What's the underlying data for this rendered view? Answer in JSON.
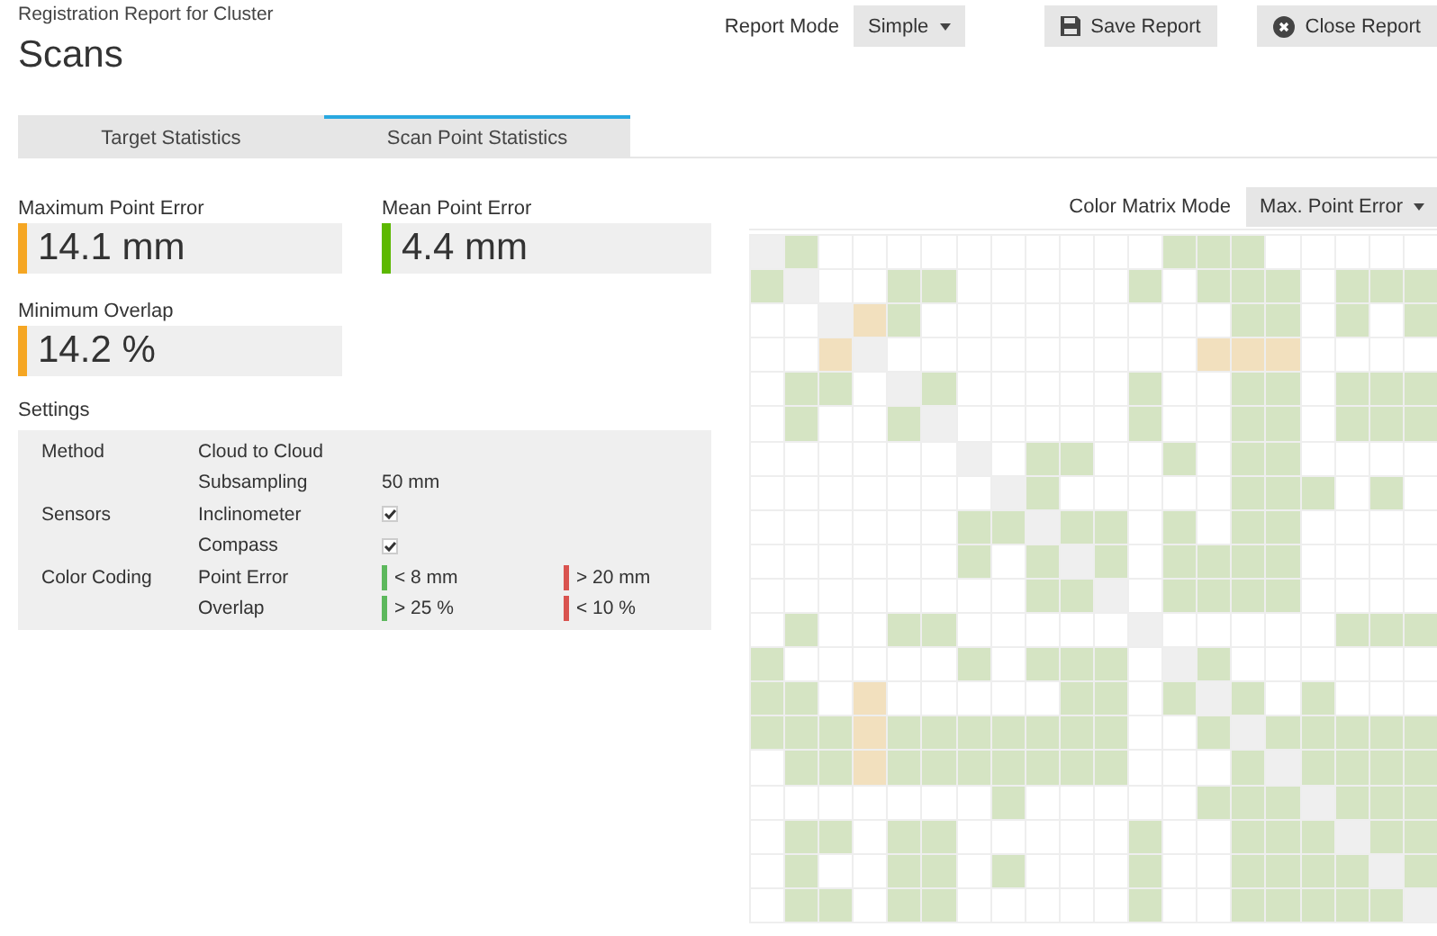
{
  "header": {
    "subtitle": "Registration Report for Cluster",
    "title": "Scans"
  },
  "toolbar": {
    "report_mode_label": "Report Mode",
    "report_mode": "Simple",
    "buttons": [
      {
        "label": "Save Report",
        "kind": "save"
      },
      {
        "label": "Close Report",
        "kind": "close"
      }
    ]
  },
  "tabs": [
    {
      "label": "Target Statistics",
      "selected": false
    },
    {
      "label": "Scan Point Statistics",
      "selected": true
    }
  ],
  "stats": [
    {
      "label": "Maximum Point Error",
      "value": "14.1 mm",
      "color": "#f5a623"
    },
    {
      "label": "Mean Point Error",
      "value": "4.4 mm",
      "color": "#5cb800"
    },
    {
      "label": "Minimum Overlap",
      "value": "14.2 %",
      "color": "#f5a623"
    }
  ],
  "settings": {
    "title": "Settings",
    "rows": [
      {
        "group": "Method",
        "name": "Cloud to Cloud",
        "kind": "text"
      },
      {
        "name": "Subsampling",
        "value": "50 mm",
        "kind": "text"
      },
      {
        "group": "Sensors",
        "name": "Inclinometer",
        "kind": "check",
        "checked": true
      },
      {
        "name": "Compass",
        "kind": "check",
        "checked": true
      },
      {
        "group": "Color Coding",
        "name": "Point Error",
        "kind": "legend",
        "good": "< 8 mm",
        "bad": "> 20 mm"
      },
      {
        "name": "Overlap",
        "kind": "legend",
        "good": "> 25 %",
        "bad": "< 10 %"
      }
    ]
  },
  "matrix": {
    "mode_label": "Color Matrix Mode",
    "mode": "Max. Point Error",
    "rows": [
      [
        {
          "kind": "diag"
        },
        {
          "kind": "good"
        },
        {
          "kind": "none"
        },
        {
          "kind": "none"
        },
        {
          "kind": "none"
        },
        {
          "kind": "none"
        },
        {
          "kind": "none"
        },
        {
          "kind": "none"
        },
        {
          "kind": "none"
        },
        {
          "kind": "none"
        },
        {
          "kind": "none"
        },
        {
          "kind": "none"
        },
        {
          "kind": "good"
        },
        {
          "kind": "good"
        },
        {
          "kind": "good"
        },
        {
          "kind": "none"
        },
        {
          "kind": "none"
        },
        {
          "kind": "none"
        },
        {
          "kind": "none"
        },
        {
          "kind": "none"
        }
      ],
      [
        {
          "kind": "good"
        },
        {
          "kind": "diag"
        },
        {
          "kind": "none"
        },
        {
          "kind": "none"
        },
        {
          "kind": "good"
        },
        {
          "kind": "good"
        },
        {
          "kind": "none"
        },
        {
          "kind": "none"
        },
        {
          "kind": "none"
        },
        {
          "kind": "none"
        },
        {
          "kind": "none"
        },
        {
          "kind": "good"
        },
        {
          "kind": "none"
        },
        {
          "kind": "good"
        },
        {
          "kind": "good"
        },
        {
          "kind": "good"
        },
        {
          "kind": "none"
        },
        {
          "kind": "good"
        },
        {
          "kind": "good"
        },
        {
          "kind": "good"
        }
      ],
      [
        {
          "kind": "none"
        },
        {
          "kind": "none"
        },
        {
          "kind": "diag"
        },
        {
          "kind": "warn"
        },
        {
          "kind": "good"
        },
        {
          "kind": "none"
        },
        {
          "kind": "none"
        },
        {
          "kind": "none"
        },
        {
          "kind": "none"
        },
        {
          "kind": "none"
        },
        {
          "kind": "none"
        },
        {
          "kind": "none"
        },
        {
          "kind": "none"
        },
        {
          "kind": "none"
        },
        {
          "kind": "good"
        },
        {
          "kind": "good"
        },
        {
          "kind": "none"
        },
        {
          "kind": "good"
        },
        {
          "kind": "none"
        },
        {
          "kind": "good"
        }
      ],
      [
        {
          "kind": "none"
        },
        {
          "kind": "none"
        },
        {
          "kind": "warn"
        },
        {
          "kind": "diag"
        },
        {
          "kind": "none"
        },
        {
          "kind": "none"
        },
        {
          "kind": "none"
        },
        {
          "kind": "none"
        },
        {
          "kind": "none"
        },
        {
          "kind": "none"
        },
        {
          "kind": "none"
        },
        {
          "kind": "none"
        },
        {
          "kind": "none"
        },
        {
          "kind": "warn"
        },
        {
          "kind": "warn"
        },
        {
          "kind": "warn"
        },
        {
          "kind": "none"
        },
        {
          "kind": "none"
        },
        {
          "kind": "none"
        },
        {
          "kind": "none"
        }
      ],
      [
        {
          "kind": "none"
        },
        {
          "kind": "good"
        },
        {
          "kind": "good"
        },
        {
          "kind": "none"
        },
        {
          "kind": "diag"
        },
        {
          "kind": "good"
        },
        {
          "kind": "none"
        },
        {
          "kind": "none"
        },
        {
          "kind": "none"
        },
        {
          "kind": "none"
        },
        {
          "kind": "none"
        },
        {
          "kind": "good"
        },
        {
          "kind": "none"
        },
        {
          "kind": "none"
        },
        {
          "kind": "good"
        },
        {
          "kind": "good"
        },
        {
          "kind": "none"
        },
        {
          "kind": "good"
        },
        {
          "kind": "good"
        },
        {
          "kind": "good"
        }
      ],
      [
        {
          "kind": "none"
        },
        {
          "kind": "good"
        },
        {
          "kind": "none"
        },
        {
          "kind": "none"
        },
        {
          "kind": "good"
        },
        {
          "kind": "diag"
        },
        {
          "kind": "none"
        },
        {
          "kind": "none"
        },
        {
          "kind": "none"
        },
        {
          "kind": "none"
        },
        {
          "kind": "none"
        },
        {
          "kind": "good"
        },
        {
          "kind": "none"
        },
        {
          "kind": "none"
        },
        {
          "kind": "good"
        },
        {
          "kind": "good"
        },
        {
          "kind": "none"
        },
        {
          "kind": "good"
        },
        {
          "kind": "good"
        },
        {
          "kind": "good"
        }
      ],
      [
        {
          "kind": "none"
        },
        {
          "kind": "none"
        },
        {
          "kind": "none"
        },
        {
          "kind": "none"
        },
        {
          "kind": "none"
        },
        {
          "kind": "none"
        },
        {
          "kind": "diag"
        },
        {
          "kind": "none"
        },
        {
          "kind": "good"
        },
        {
          "kind": "good"
        },
        {
          "kind": "none"
        },
        {
          "kind": "none"
        },
        {
          "kind": "good"
        },
        {
          "kind": "none"
        },
        {
          "kind": "good"
        },
        {
          "kind": "good"
        },
        {
          "kind": "none"
        },
        {
          "kind": "none"
        },
        {
          "kind": "none"
        },
        {
          "kind": "none"
        }
      ],
      [
        {
          "kind": "none"
        },
        {
          "kind": "none"
        },
        {
          "kind": "none"
        },
        {
          "kind": "none"
        },
        {
          "kind": "none"
        },
        {
          "kind": "none"
        },
        {
          "kind": "none"
        },
        {
          "kind": "diag"
        },
        {
          "kind": "good"
        },
        {
          "kind": "none"
        },
        {
          "kind": "none"
        },
        {
          "kind": "none"
        },
        {
          "kind": "none"
        },
        {
          "kind": "none"
        },
        {
          "kind": "good"
        },
        {
          "kind": "good"
        },
        {
          "kind": "good"
        },
        {
          "kind": "none"
        },
        {
          "kind": "good"
        },
        {
          "kind": "none"
        }
      ],
      [
        {
          "kind": "none"
        },
        {
          "kind": "none"
        },
        {
          "kind": "none"
        },
        {
          "kind": "none"
        },
        {
          "kind": "none"
        },
        {
          "kind": "none"
        },
        {
          "kind": "good"
        },
        {
          "kind": "good"
        },
        {
          "kind": "diag"
        },
        {
          "kind": "good"
        },
        {
          "kind": "good"
        },
        {
          "kind": "none"
        },
        {
          "kind": "good"
        },
        {
          "kind": "none"
        },
        {
          "kind": "good"
        },
        {
          "kind": "good"
        },
        {
          "kind": "none"
        },
        {
          "kind": "none"
        },
        {
          "kind": "none"
        },
        {
          "kind": "none"
        }
      ],
      [
        {
          "kind": "none"
        },
        {
          "kind": "none"
        },
        {
          "kind": "none"
        },
        {
          "kind": "none"
        },
        {
          "kind": "none"
        },
        {
          "kind": "none"
        },
        {
          "kind": "good"
        },
        {
          "kind": "none"
        },
        {
          "kind": "good"
        },
        {
          "kind": "diag"
        },
        {
          "kind": "good"
        },
        {
          "kind": "none"
        },
        {
          "kind": "good"
        },
        {
          "kind": "good"
        },
        {
          "kind": "good"
        },
        {
          "kind": "good"
        },
        {
          "kind": "none"
        },
        {
          "kind": "none"
        },
        {
          "kind": "none"
        },
        {
          "kind": "none"
        }
      ],
      [
        {
          "kind": "none"
        },
        {
          "kind": "none"
        },
        {
          "kind": "none"
        },
        {
          "kind": "none"
        },
        {
          "kind": "none"
        },
        {
          "kind": "none"
        },
        {
          "kind": "none"
        },
        {
          "kind": "none"
        },
        {
          "kind": "good"
        },
        {
          "kind": "good"
        },
        {
          "kind": "diag"
        },
        {
          "kind": "none"
        },
        {
          "kind": "good"
        },
        {
          "kind": "good"
        },
        {
          "kind": "good"
        },
        {
          "kind": "good"
        },
        {
          "kind": "none"
        },
        {
          "kind": "none"
        },
        {
          "kind": "none"
        },
        {
          "kind": "none"
        }
      ],
      [
        {
          "kind": "none"
        },
        {
          "kind": "good"
        },
        {
          "kind": "none"
        },
        {
          "kind": "none"
        },
        {
          "kind": "good"
        },
        {
          "kind": "good"
        },
        {
          "kind": "none"
        },
        {
          "kind": "none"
        },
        {
          "kind": "none"
        },
        {
          "kind": "none"
        },
        {
          "kind": "none"
        },
        {
          "kind": "diag"
        },
        {
          "kind": "none"
        },
        {
          "kind": "none"
        },
        {
          "kind": "none"
        },
        {
          "kind": "none"
        },
        {
          "kind": "none"
        },
        {
          "kind": "good"
        },
        {
          "kind": "good"
        },
        {
          "kind": "good"
        }
      ],
      [
        {
          "kind": "good"
        },
        {
          "kind": "none"
        },
        {
          "kind": "none"
        },
        {
          "kind": "none"
        },
        {
          "kind": "none"
        },
        {
          "kind": "none"
        },
        {
          "kind": "good"
        },
        {
          "kind": "none"
        },
        {
          "kind": "good"
        },
        {
          "kind": "good"
        },
        {
          "kind": "good"
        },
        {
          "kind": "none"
        },
        {
          "kind": "diag"
        },
        {
          "kind": "good"
        },
        {
          "kind": "none"
        },
        {
          "kind": "none"
        },
        {
          "kind": "none"
        },
        {
          "kind": "none"
        },
        {
          "kind": "none"
        },
        {
          "kind": "none"
        }
      ],
      [
        {
          "kind": "good"
        },
        {
          "kind": "good"
        },
        {
          "kind": "none"
        },
        {
          "kind": "warn"
        },
        {
          "kind": "none"
        },
        {
          "kind": "none"
        },
        {
          "kind": "none"
        },
        {
          "kind": "none"
        },
        {
          "kind": "none"
        },
        {
          "kind": "good"
        },
        {
          "kind": "good"
        },
        {
          "kind": "none"
        },
        {
          "kind": "good"
        },
        {
          "kind": "diag"
        },
        {
          "kind": "good"
        },
        {
          "kind": "none"
        },
        {
          "kind": "good"
        },
        {
          "kind": "none"
        },
        {
          "kind": "none"
        },
        {
          "kind": "none"
        }
      ],
      [
        {
          "kind": "good"
        },
        {
          "kind": "good"
        },
        {
          "kind": "good"
        },
        {
          "kind": "warn"
        },
        {
          "kind": "good"
        },
        {
          "kind": "good"
        },
        {
          "kind": "good"
        },
        {
          "kind": "good"
        },
        {
          "kind": "good"
        },
        {
          "kind": "good"
        },
        {
          "kind": "good"
        },
        {
          "kind": "none"
        },
        {
          "kind": "none"
        },
        {
          "kind": "good"
        },
        {
          "kind": "diag"
        },
        {
          "kind": "good"
        },
        {
          "kind": "good"
        },
        {
          "kind": "good"
        },
        {
          "kind": "good"
        },
        {
          "kind": "good"
        }
      ],
      [
        {
          "kind": "none"
        },
        {
          "kind": "good"
        },
        {
          "kind": "good"
        },
        {
          "kind": "warn"
        },
        {
          "kind": "good"
        },
        {
          "kind": "good"
        },
        {
          "kind": "good"
        },
        {
          "kind": "good"
        },
        {
          "kind": "good"
        },
        {
          "kind": "good"
        },
        {
          "kind": "good"
        },
        {
          "kind": "none"
        },
        {
          "kind": "none"
        },
        {
          "kind": "none"
        },
        {
          "kind": "good"
        },
        {
          "kind": "diag"
        },
        {
          "kind": "good"
        },
        {
          "kind": "good"
        },
        {
          "kind": "good"
        },
        {
          "kind": "good"
        }
      ],
      [
        {
          "kind": "none"
        },
        {
          "kind": "none"
        },
        {
          "kind": "none"
        },
        {
          "kind": "none"
        },
        {
          "kind": "none"
        },
        {
          "kind": "none"
        },
        {
          "kind": "none"
        },
        {
          "kind": "good"
        },
        {
          "kind": "none"
        },
        {
          "kind": "none"
        },
        {
          "kind": "none"
        },
        {
          "kind": "none"
        },
        {
          "kind": "none"
        },
        {
          "kind": "good"
        },
        {
          "kind": "good"
        },
        {
          "kind": "good"
        },
        {
          "kind": "diag"
        },
        {
          "kind": "good"
        },
        {
          "kind": "good"
        },
        {
          "kind": "good"
        }
      ],
      [
        {
          "kind": "none"
        },
        {
          "kind": "good"
        },
        {
          "kind": "good"
        },
        {
          "kind": "none"
        },
        {
          "kind": "good"
        },
        {
          "kind": "good"
        },
        {
          "kind": "none"
        },
        {
          "kind": "none"
        },
        {
          "kind": "none"
        },
        {
          "kind": "none"
        },
        {
          "kind": "none"
        },
        {
          "kind": "good"
        },
        {
          "kind": "none"
        },
        {
          "kind": "none"
        },
        {
          "kind": "good"
        },
        {
          "kind": "good"
        },
        {
          "kind": "good"
        },
        {
          "kind": "diag"
        },
        {
          "kind": "good"
        },
        {
          "kind": "good"
        }
      ],
      [
        {
          "kind": "none"
        },
        {
          "kind": "good"
        },
        {
          "kind": "none"
        },
        {
          "kind": "none"
        },
        {
          "kind": "good"
        },
        {
          "kind": "good"
        },
        {
          "kind": "none"
        },
        {
          "kind": "good"
        },
        {
          "kind": "none"
        },
        {
          "kind": "none"
        },
        {
          "kind": "none"
        },
        {
          "kind": "good"
        },
        {
          "kind": "none"
        },
        {
          "kind": "none"
        },
        {
          "kind": "good"
        },
        {
          "kind": "good"
        },
        {
          "kind": "good"
        },
        {
          "kind": "good"
        },
        {
          "kind": "diag"
        },
        {
          "kind": "good"
        }
      ],
      [
        {
          "kind": "none"
        },
        {
          "kind": "good"
        },
        {
          "kind": "good"
        },
        {
          "kind": "none"
        },
        {
          "kind": "good"
        },
        {
          "kind": "good"
        },
        {
          "kind": "none"
        },
        {
          "kind": "none"
        },
        {
          "kind": "none"
        },
        {
          "kind": "none"
        },
        {
          "kind": "none"
        },
        {
          "kind": "good"
        },
        {
          "kind": "none"
        },
        {
          "kind": "none"
        },
        {
          "kind": "good"
        },
        {
          "kind": "good"
        },
        {
          "kind": "good"
        },
        {
          "kind": "good"
        },
        {
          "kind": "good"
        },
        {
          "kind": "diag"
        }
      ]
    ]
  }
}
